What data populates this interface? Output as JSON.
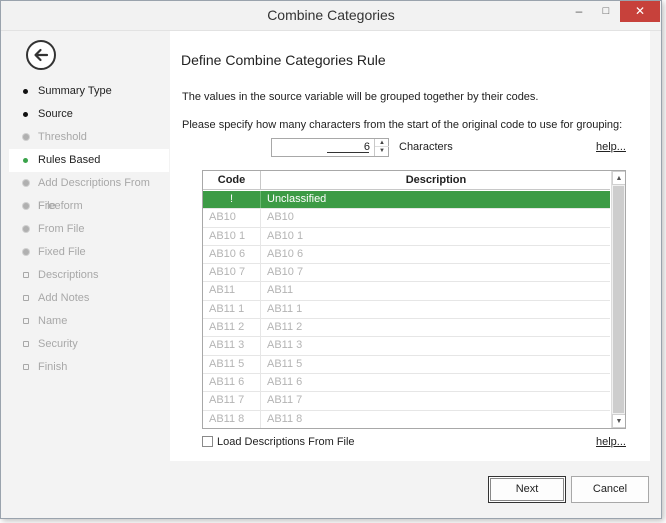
{
  "window": {
    "title": "Combine Categories",
    "minimize_glyph": "–",
    "maximize_glyph": "□",
    "close_glyph": "✕"
  },
  "sidebar": {
    "back_icon": "back-arrow-icon",
    "steps": [
      {
        "label": "Summary Type",
        "state": "done"
      },
      {
        "label": "Source",
        "state": "done"
      },
      {
        "label": "Threshold",
        "state": "disabled"
      },
      {
        "label": "Rules Based",
        "state": "active"
      },
      {
        "label": "Add Descriptions From File",
        "state": "disabled"
      },
      {
        "label": "Freeform",
        "state": "disabled"
      },
      {
        "label": "From File",
        "state": "disabled"
      },
      {
        "label": "Fixed File",
        "state": "disabled"
      },
      {
        "label": "Descriptions",
        "state": "disabled"
      },
      {
        "label": "Add Notes",
        "state": "disabled"
      },
      {
        "label": "Name",
        "state": "disabled"
      },
      {
        "label": "Security",
        "state": "disabled"
      },
      {
        "label": "Finish",
        "state": "disabled"
      }
    ]
  },
  "main": {
    "heading": "Define Combine Categories Rule",
    "description": "The values in the source variable will be grouped together by their codes.",
    "instruction": "Please specify how many characters from the start of the original code to use for grouping:",
    "characters_value": "6",
    "characters_label": "Characters",
    "help_link": "help...",
    "help_link_2": "help...",
    "table": {
      "columns": [
        "Code",
        "Description"
      ],
      "rows": [
        {
          "code": "!",
          "description": "Unclassified",
          "selected": true
        },
        {
          "code": "AB10",
          "description": "AB10"
        },
        {
          "code": "AB10 1",
          "description": "AB10 1"
        },
        {
          "code": "AB10 6",
          "description": "AB10 6"
        },
        {
          "code": "AB10 7",
          "description": "AB10 7"
        },
        {
          "code": "AB11",
          "description": "AB11"
        },
        {
          "code": "AB11 1",
          "description": "AB11 1"
        },
        {
          "code": "AB11 2",
          "description": "AB11 2"
        },
        {
          "code": "AB11 3",
          "description": "AB11 3"
        },
        {
          "code": "AB11 5",
          "description": "AB11 5"
        },
        {
          "code": "AB11 6",
          "description": "AB11 6"
        },
        {
          "code": "AB11 7",
          "description": "AB11 7"
        },
        {
          "code": "AB11 8",
          "description": "AB11 8"
        }
      ]
    },
    "load_descriptions_label": "Load Descriptions From File",
    "load_descriptions_checked": false
  },
  "footer": {
    "next_label": "Next",
    "cancel_label": "Cancel"
  },
  "colors": {
    "selected_row": "#3c9b45",
    "close_button": "#c7413b",
    "active_bullet": "#3aa34a"
  }
}
